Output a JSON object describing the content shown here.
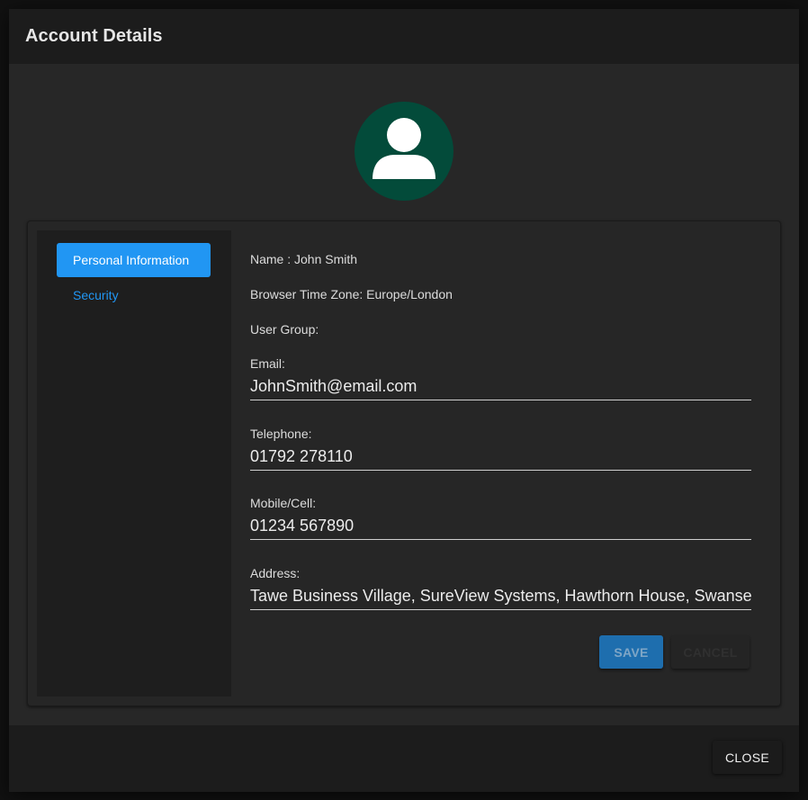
{
  "dialog": {
    "title": "Account Details"
  },
  "avatar": {
    "icon": "person-icon",
    "bg_color": "#034b3a"
  },
  "nav": {
    "items": [
      {
        "label": "Personal Information",
        "active": true
      },
      {
        "label": "Security",
        "active": false
      }
    ]
  },
  "info": {
    "name_line": "Name : John Smith",
    "timezone_line": "Browser Time Zone: Europe/London",
    "group_line": "User Group:"
  },
  "fields": {
    "email": {
      "label": "Email:",
      "value": "JohnSmith@email.com"
    },
    "telephone": {
      "label": "Telephone:",
      "value": "01792 278110"
    },
    "mobile": {
      "label": "Mobile/Cell:",
      "value": "01234 567890"
    },
    "address": {
      "label": "Address:",
      "value": "Tawe Business Village, SureView Systems, Hawthorn House, Swansea"
    }
  },
  "actions": {
    "save_label": "SAVE",
    "cancel_label": "CANCEL",
    "close_label": "CLOSE"
  },
  "colors": {
    "accent": "#2196f3",
    "background": "#272727"
  }
}
